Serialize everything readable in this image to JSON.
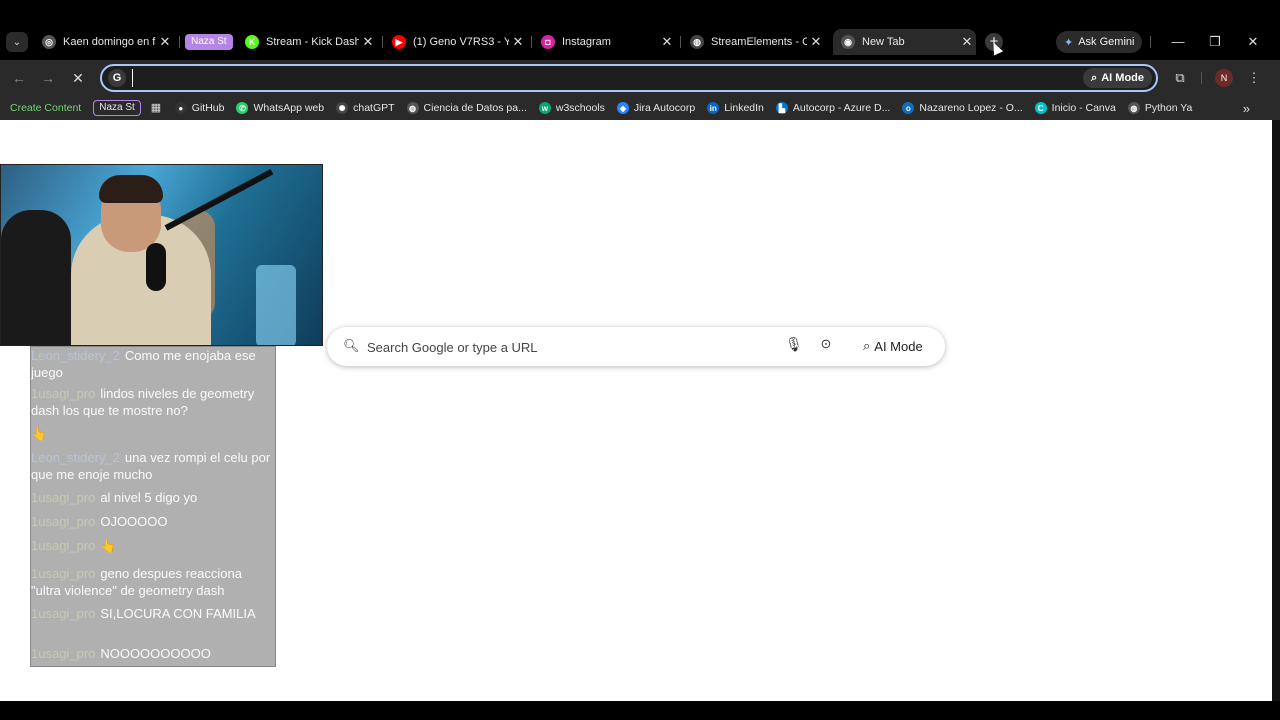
{
  "tabs": [
    {
      "title": "Kaen domingo en fa",
      "favicon_color": "#555555",
      "fav_glyph": "◎"
    },
    {
      "title": "Stream - Kick Dashb",
      "favicon_color": "#53fc18",
      "fav_glyph": "K"
    },
    {
      "title": "(1) Geno V7RS3 - Yo",
      "favicon_color": "#ff0000",
      "fav_glyph": "▶"
    },
    {
      "title": "Instagram",
      "favicon_color": "#d6249f",
      "fav_glyph": "◘"
    },
    {
      "title": "StreamElements - O",
      "favicon_color": "#444444",
      "fav_glyph": "◍"
    },
    {
      "title": "New Tab",
      "favicon_color": "#555555",
      "fav_glyph": "◉"
    }
  ],
  "tab_group_label": "Naza St",
  "new_tab_glyph": "+",
  "gemini_label": "Ask Gemini",
  "window": {
    "minimize": "—",
    "restore": "❐",
    "close": "✕"
  },
  "toolbar": {
    "omnibox_value": "",
    "ai_mode_label": "AI Mode"
  },
  "bookmarks": {
    "create_content": "Create Content",
    "group_chip": "Naza St",
    "items": [
      {
        "label": "GitHub",
        "color": "#333333",
        "glyph": "●"
      },
      {
        "label": "WhatsApp web",
        "color": "#25d366",
        "glyph": "✆"
      },
      {
        "label": "chatGPT",
        "color": "#444444",
        "glyph": "✺"
      },
      {
        "label": "Ciencia de Datos pa...",
        "color": "#555555",
        "glyph": "◍"
      },
      {
        "label": "w3schools",
        "color": "#04aa6d",
        "glyph": "w"
      },
      {
        "label": "Jira Autocorp",
        "color": "#2684ff",
        "glyph": "◆"
      },
      {
        "label": "LinkedIn",
        "color": "#0a66c2",
        "glyph": "in"
      },
      {
        "label": "Autocorp - Azure D...",
        "color": "#0078d4",
        "glyph": "▙"
      },
      {
        "label": "Nazareno Lopez - O...",
        "color": "#0f6cbd",
        "glyph": "o"
      },
      {
        "label": "Inicio - Canva",
        "color": "#00c4cc",
        "glyph": "C"
      },
      {
        "label": "Python Ya",
        "color": "#555555",
        "glyph": "◍"
      }
    ]
  },
  "search": {
    "placeholder": "Search Google or type a URL",
    "ai_mode_label": "AI Mode"
  },
  "chat": [
    {
      "user": "Leon_stidery_2",
      "text": "Como me enojaba ese juego",
      "user_class": "blue"
    },
    {
      "user": "1usagi_pro",
      "text": "lindos niveles de geometry dash los que te mostre no?",
      "user_class": ""
    },
    {
      "user": "",
      "text": "👆",
      "user_class": ""
    },
    {
      "user": "Leon_stidery_2",
      "text": "una vez rompi el celu por que me enoje mucho",
      "user_class": "blue"
    },
    {
      "user": "1usagi_pro",
      "text": "al nivel 5 digo yo",
      "user_class": ""
    },
    {
      "user": "1usagi_pro",
      "text": "OJOOOOO",
      "user_class": ""
    },
    {
      "user": "1usagi_pro",
      "text": "👆",
      "user_class": ""
    },
    {
      "user": "1usagi_pro",
      "text": "geno despues reacciona \"ultra violence\" de geometry dash",
      "user_class": ""
    },
    {
      "user": "1usagi_pro",
      "text": "SI,LOCURA CON FAMILIA",
      "user_class": ""
    },
    {
      "user": "1usagi_pro",
      "text": "NOOOOOOOOOO",
      "user_class": ""
    }
  ]
}
